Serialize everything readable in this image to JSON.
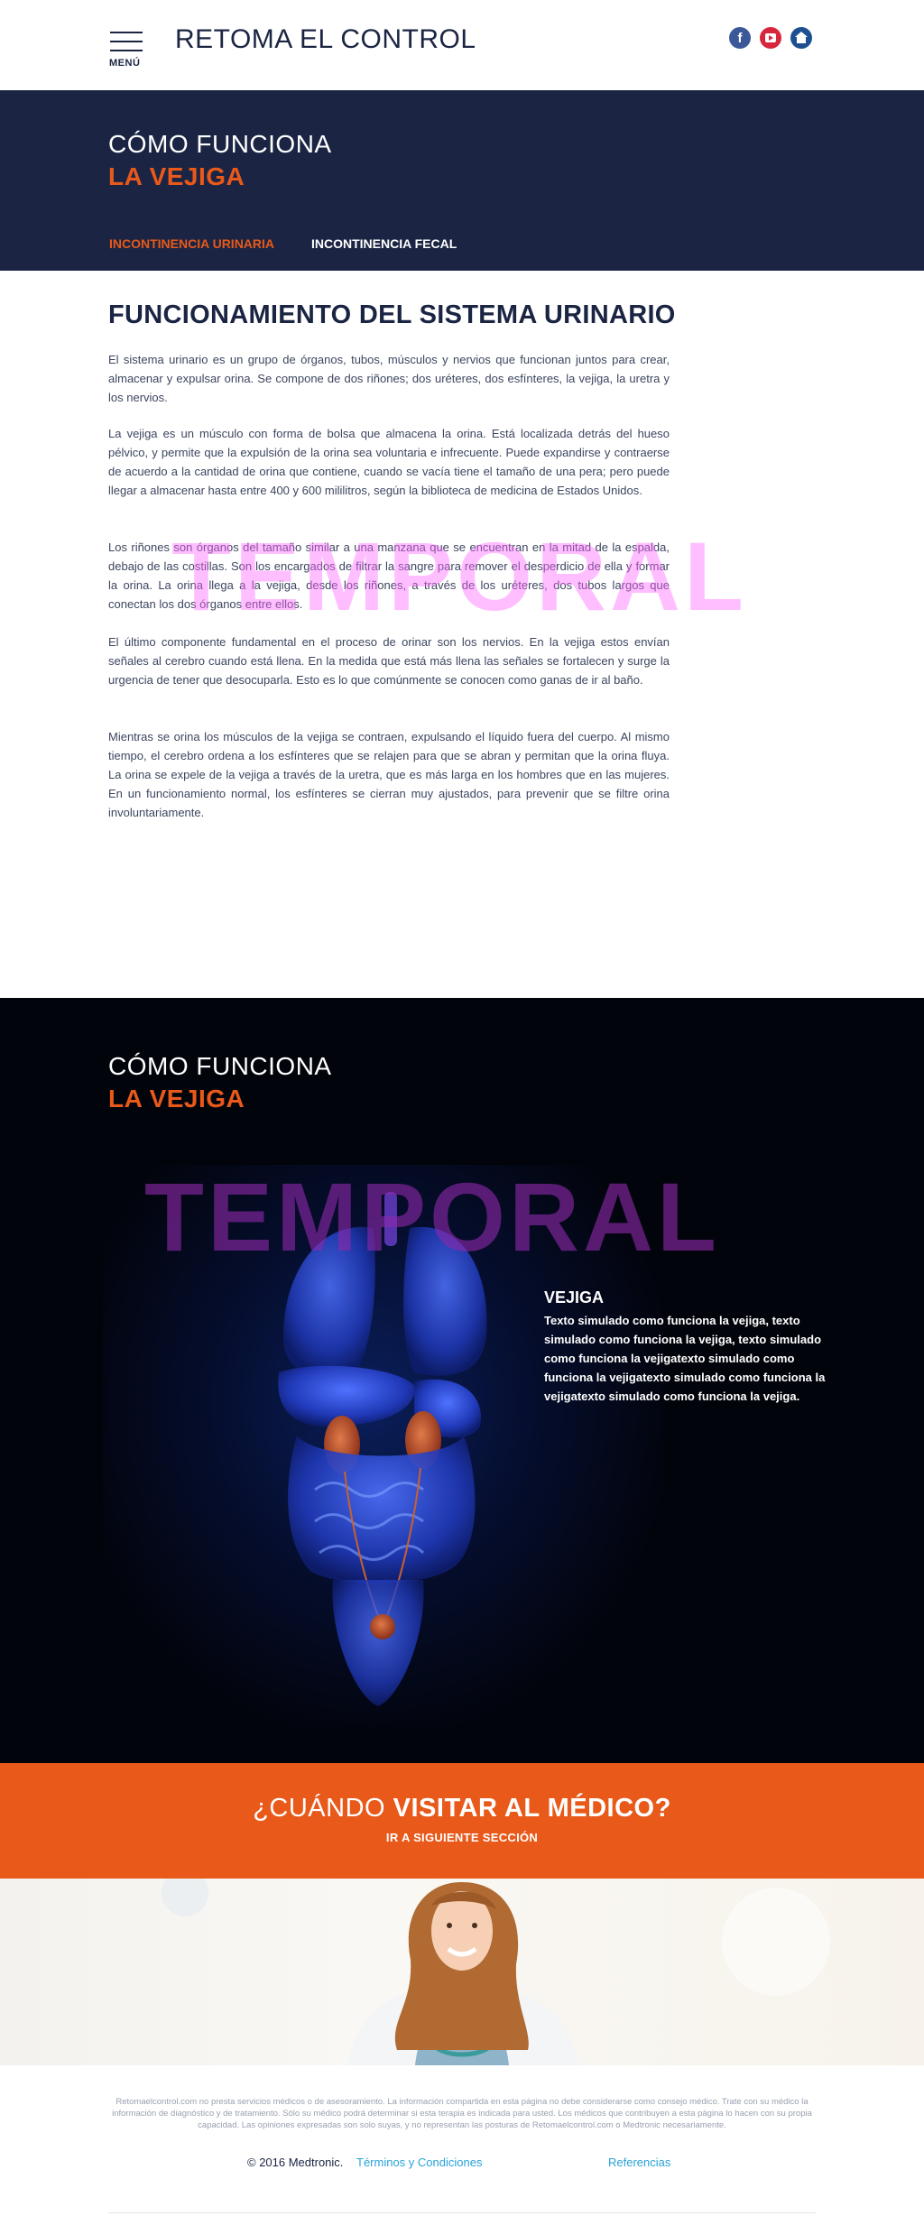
{
  "header": {
    "menu_label": "MENÚ",
    "site_title": "RETOMA EL CONTROL",
    "social": [
      "facebook-icon",
      "youtube-icon",
      "home-icon"
    ],
    "facebook_glyph": "f"
  },
  "hero": {
    "line1": "CÓMO FUNCIONA",
    "line2": "LA VEJIGA",
    "tabs": [
      {
        "label": "INCONTINENCIA URINARIA",
        "active": true
      },
      {
        "label": "INCONTINENCIA FECAL",
        "active": false
      }
    ]
  },
  "article": {
    "heading_light": "FUNCIONAMIENTO DEL ",
    "heading_bold": "SISTEMA URINARIO",
    "paragraphs": [
      "El sistema urinario es un grupo de órganos, tubos, músculos y nervios que funcionan juntos para crear, almacenar y expulsar orina. Se compone de dos riñones; dos uréteres, dos esfínteres, la vejiga, la uretra y los nervios.",
      "La vejiga es un músculo con forma de bolsa que almacena la orina. Está localizada detrás del hueso pélvico, y permite que la expulsión de la orina sea voluntaria e infrecuente. Puede expandirse y contraerse de acuerdo a la cantidad de orina que contiene, cuando se vacía tiene el tamaño de una pera; pero puede llegar a almacenar hasta entre 400 y 600 mililitros, según la biblioteca de medicina de Estados Unidos.",
      "Los riñones son órganos del tamaño similar a una manzana que se encuentran en la mitad de la espalda, debajo de las costillas. Son los encargados de filtrar la sangre para remover el desperdicio de ella y formar la orina. La orina llega a la vejiga, desde los riñones, a través de los uréteres, dos tubos largos que conectan los dos órganos entre ellos.",
      "El último componente fundamental en el proceso de orinar son los nervios. En la vejiga estos envían señales al cerebro cuando está llena. En la medida que está más llena las señales se fortalecen y surge la urgencia de tener que desocuparla. Esto es lo que comúnmente se conocen como ganas de ir al baño.",
      "Mientras se orina los músculos de la vejiga se contraen, expulsando el líquido fuera del cuerpo. Al mismo tiempo, el cerebro ordena a los esfínteres que se relajen para que  se abran y permitan que la orina fluya. La orina se expele de la vejiga a través de la uretra, que es más larga en los hombres que en las mujeres. En un funcionamiento normal, los esfínteres se cierran muy ajustados, para prevenir que se filtre orina involuntariamente."
    ],
    "watermark": "TEMPORAL"
  },
  "anatomy_section": {
    "line1": "CÓMO FUNCIONA",
    "line2": "LA VEJIGA",
    "watermark": "TEMPORAL",
    "info_title": "VEJIGA",
    "info_text": "Texto simulado como funciona la vejiga, texto simulado como funciona la vejiga, texto simulado como funciona la vejigatexto simulado como funciona la vejigatexto simulado como funciona la vejigatexto simulado como funciona la vejiga."
  },
  "cta": {
    "title_light": "¿CUÁNDO ",
    "title_bold": "VISITAR AL MÉDICO?",
    "link": "IR A SIGUIENTE SECCIÓN"
  },
  "footer": {
    "disclaimer": "Retomaelcontrol.com no presta servicios médicos o de asesoramiento. La información compartida en esta página no debe considerarse como consejo médico. Trate con su médico la información de diagnóstico y de tratamiento. Sólo su médico podrá determinar si esta terapia es indicada para usted. Los médicos que contribuyen a esta página lo hacen con su propia capacidad. Las opiniones expresadas son solo suyas, y no representan las posturas de Retomaelcontrol.com o Medtronic necesariamente.",
    "copyright": "© 2016 Medtronic.",
    "terms": "Términos y Condiciones",
    "references": "Referencias"
  },
  "colors": {
    "navy": "#1b2543",
    "orange": "#e8591a",
    "link_blue": "#2aa3d8",
    "dark_bg": "#02040b",
    "facebook": "#3b5998",
    "youtube": "#d7263d",
    "home": "#1d4f91"
  }
}
